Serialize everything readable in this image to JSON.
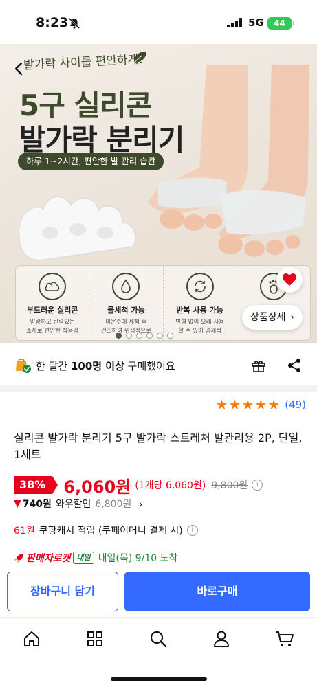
{
  "status": {
    "time": "8:23",
    "network": "5G",
    "battery": "44"
  },
  "hero": {
    "tagline": "발가락 사이를 편안하게!",
    "title_line1": "5구 실리콘",
    "title_line2": "발가락 분리기",
    "pill": "하루 1~2시간, 편안한 발 관리 습관",
    "features": [
      {
        "icon": "cloud-icon",
        "title": "부드러운 실리콘",
        "desc1": "말랑하고 탄력있는",
        "desc2": "소재로 편안한 착용감"
      },
      {
        "icon": "water-drop-icon",
        "title": "물세척 가능",
        "desc1": "미온수에 세척 후",
        "desc2": "건조하여 위생적으로"
      },
      {
        "icon": "recycle-icon",
        "title": "반복 사용 가능",
        "desc1": "변형 없이 오래 사용",
        "desc2": "할 수 있어 경제적"
      },
      {
        "icon": "footprint-icon",
        "title": "",
        "desc1": "",
        "desc2": ""
      }
    ],
    "detail_button": "상품상세",
    "slide_count": 6,
    "active_slide": 1
  },
  "purchase": {
    "prefix": "한 달간",
    "count": "100명 이상",
    "suffix": "구매했어요"
  },
  "rating": {
    "stars": 5,
    "count": "(49)"
  },
  "product": {
    "title": "실리콘 발가락 분리기 5구 발가락 스트레처 발관리용 2P, 단일, 1세트"
  },
  "price": {
    "discount": "38%",
    "price": "6,060원",
    "unit_price": "(1개당 6,060원)",
    "original": "9,800원",
    "info": "i"
  },
  "wow": {
    "arrow": "🡇",
    "amount": "740원",
    "label": "와우할인",
    "original": "6,800원",
    "chevron": "›"
  },
  "cash": {
    "amount": "61원",
    "text": "쿠팡캐시 적립 (쿠페이머니 결제 시)"
  },
  "delivery": {
    "rocket": "판매자로켓",
    "badge": "내일",
    "arrival": "내일(목) 9/10 도착"
  },
  "actions": {
    "cart": "장바구니 담기",
    "buy": "바로구매"
  },
  "tabs": [
    "home-icon",
    "category-grid-icon",
    "search-icon",
    "profile-icon",
    "cart-icon"
  ],
  "colors": {
    "accent": "#346aff",
    "sale": "#e8001c",
    "rating": "#ff7a00",
    "brand_green": "#3d4b2c",
    "delivery_green": "#1a8a3a"
  }
}
